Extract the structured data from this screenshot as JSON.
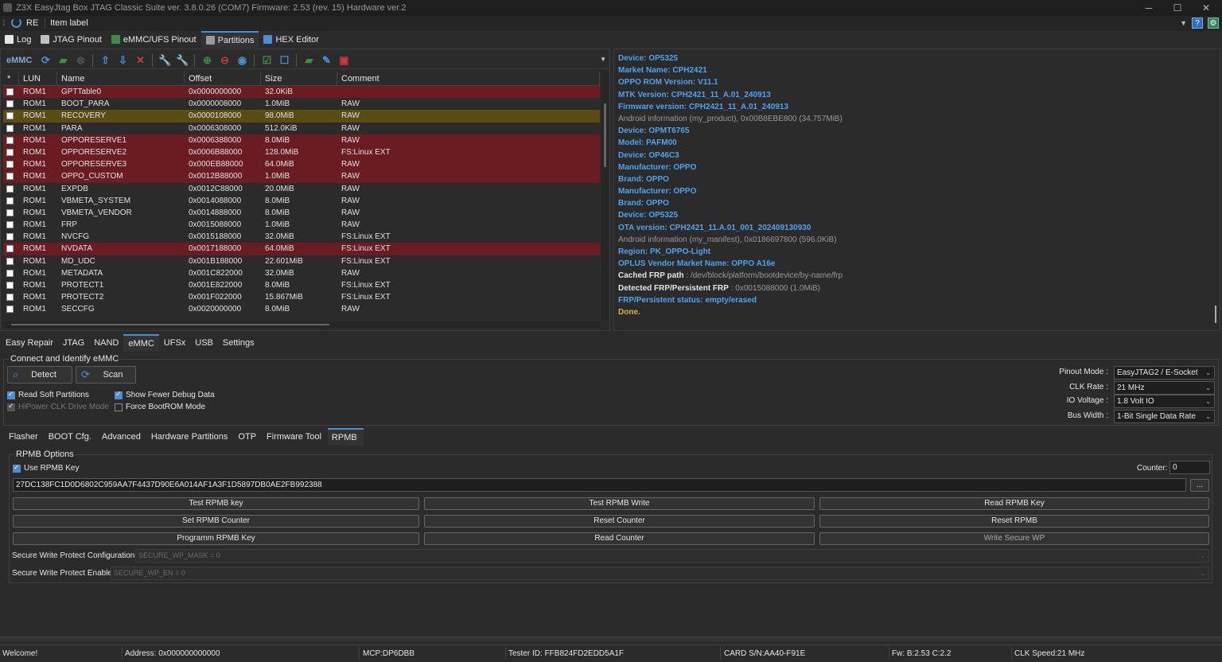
{
  "window": {
    "title": "Z3X EasyJtag Box JTAG Classic Suite ver. 3.8.0.26 (COM7) Firmware: 2.53 (rev. 15) Hardware ver.2",
    "minimize": "─",
    "maximize": "☐",
    "close": "✕"
  },
  "menubar": {
    "re_label": "RE",
    "item_label": "Item label",
    "dropdown": "▼",
    "help": "?",
    "settings": "⚙"
  },
  "top_tabs": [
    {
      "label": "Log",
      "icon": "log-icon",
      "color": "#e6e6e6"
    },
    {
      "label": "JTAG Pinout",
      "icon": "chip-icon",
      "color": "#c0c0c0"
    },
    {
      "label": "eMMC/UFS Pinout",
      "icon": "board-icon",
      "color": "#3e8e41"
    },
    {
      "label": "Partitions",
      "icon": "disk-icon",
      "color": "#9a9a9a",
      "active": true
    },
    {
      "label": "HEX Editor",
      "icon": "hex-icon",
      "color": "#4a8fd4"
    }
  ],
  "toolbar": {
    "emmc_label": "eMMC",
    "icons": [
      {
        "name": "refresh-icon",
        "glyph": "⟳",
        "color": "#4a8fd4"
      },
      {
        "name": "folder-open-icon",
        "glyph": "▰",
        "color": "#3e8e41"
      },
      {
        "name": "stop-icon",
        "glyph": "⊗",
        "color": "#555"
      },
      {
        "name": "upload-icon",
        "glyph": "⇧",
        "color": "#4a8fd4"
      },
      {
        "name": "download-icon",
        "glyph": "⇩",
        "color": "#4a8fd4"
      },
      {
        "name": "delete-icon",
        "glyph": "✕",
        "color": "#d23a3a"
      },
      {
        "name": "wrench-icon",
        "glyph": "🔧",
        "color": "#4a8fd4"
      },
      {
        "name": "tool-icon",
        "glyph": "🔧",
        "color": "#4a8fd4"
      },
      {
        "name": "add-icon",
        "glyph": "⊕",
        "color": "#3e8e41"
      },
      {
        "name": "remove-icon",
        "glyph": "⊖",
        "color": "#c23a3a"
      },
      {
        "name": "target-icon",
        "glyph": "◉",
        "color": "#4a8fd4"
      },
      {
        "name": "check-all-icon",
        "glyph": "☑",
        "color": "#3e8e41"
      },
      {
        "name": "uncheck-all-icon",
        "glyph": "☐",
        "color": "#4a8fd4"
      },
      {
        "name": "folder-icon",
        "glyph": "▰",
        "color": "#3e8e41"
      },
      {
        "name": "edit-icon",
        "glyph": "✎",
        "color": "#4a8fd4"
      },
      {
        "name": "erase-icon",
        "glyph": "▣",
        "color": "#d23a3a"
      }
    ],
    "menu_arrow": "▼"
  },
  "partitions": {
    "columns": [
      "*",
      "LUN",
      "Name",
      "Offset",
      "Size",
      "Comment"
    ],
    "rows": [
      {
        "lun": "ROM1",
        "name": "GPTTable0",
        "offset": "0x0000000000",
        "size": "32.0KiB",
        "comment": "",
        "hl": "red"
      },
      {
        "lun": "ROM1",
        "name": "BOOT_PARA",
        "offset": "0x0000008000",
        "size": "1.0MiB",
        "comment": "RAW",
        "hl": ""
      },
      {
        "lun": "ROM1",
        "name": "RECOVERY",
        "offset": "0x0000108000",
        "size": "98.0MiB",
        "comment": "RAW",
        "hl": "yellow"
      },
      {
        "lun": "ROM1",
        "name": "PARA",
        "offset": "0x0006308000",
        "size": "512.0KiB",
        "comment": "RAW",
        "hl": ""
      },
      {
        "lun": "ROM1",
        "name": "OPPORESERVE1",
        "offset": "0x0006388000",
        "size": "8.0MiB",
        "comment": "RAW",
        "hl": "red"
      },
      {
        "lun": "ROM1",
        "name": "OPPORESERVE2",
        "offset": "0x0006B88000",
        "size": "128.0MiB",
        "comment": "FS:Linux EXT",
        "hl": "red"
      },
      {
        "lun": "ROM1",
        "name": "OPPORESERVE3",
        "offset": "0x000EB88000",
        "size": "64.0MiB",
        "comment": "RAW",
        "hl": "red"
      },
      {
        "lun": "ROM1",
        "name": "OPPO_CUSTOM",
        "offset": "0x0012B88000",
        "size": "1.0MiB",
        "comment": "RAW",
        "hl": "red"
      },
      {
        "lun": "ROM1",
        "name": "EXPDB",
        "offset": "0x0012C88000",
        "size": "20.0MiB",
        "comment": "RAW",
        "hl": ""
      },
      {
        "lun": "ROM1",
        "name": "VBMETA_SYSTEM",
        "offset": "0x0014088000",
        "size": "8.0MiB",
        "comment": "RAW",
        "hl": ""
      },
      {
        "lun": "ROM1",
        "name": "VBMETA_VENDOR",
        "offset": "0x0014888000",
        "size": "8.0MiB",
        "comment": "RAW",
        "hl": ""
      },
      {
        "lun": "ROM1",
        "name": "FRP",
        "offset": "0x0015088000",
        "size": "1.0MiB",
        "comment": "RAW",
        "hl": ""
      },
      {
        "lun": "ROM1",
        "name": "NVCFG",
        "offset": "0x0015188000",
        "size": "32.0MiB",
        "comment": "FS:Linux EXT",
        "hl": ""
      },
      {
        "lun": "ROM1",
        "name": "NVDATA",
        "offset": "0x0017188000",
        "size": "64.0MiB",
        "comment": "FS:Linux EXT",
        "hl": "red"
      },
      {
        "lun": "ROM1",
        "name": "MD_UDC",
        "offset": "0x001B188000",
        "size": "22.601MiB",
        "comment": "FS:Linux EXT",
        "hl": ""
      },
      {
        "lun": "ROM1",
        "name": "METADATA",
        "offset": "0x001C822000",
        "size": "32.0MiB",
        "comment": "RAW",
        "hl": ""
      },
      {
        "lun": "ROM1",
        "name": "PROTECT1",
        "offset": "0x001E822000",
        "size": "8.0MiB",
        "comment": "FS:Linux EXT",
        "hl": ""
      },
      {
        "lun": "ROM1",
        "name": "PROTECT2",
        "offset": "0x001F022000",
        "size": "15.867MiB",
        "comment": "FS:Linux EXT",
        "hl": ""
      },
      {
        "lun": "ROM1",
        "name": "SECCFG",
        "offset": "0x0020000000",
        "size": "8.0MiB",
        "comment": "RAW",
        "hl": ""
      }
    ]
  },
  "log": [
    {
      "t": "b",
      "text": "Device: OP5325"
    },
    {
      "t": "b",
      "text": "Market Name: CPH2421"
    },
    {
      "t": "b",
      "text": "OPPO ROM Version: V11.1"
    },
    {
      "t": "b",
      "text": "MTK Version: CPH2421_11_A.01_240913"
    },
    {
      "t": "b",
      "text": "Firmware version: CPH2421_11_A.01_240913"
    },
    {
      "t": "g",
      "text": "Android information (my_product), 0x00B8EBE800 (34.757MiB)"
    },
    {
      "t": "b",
      "text": "Device: OPMT6765"
    },
    {
      "t": "b",
      "text": "Model: PAFM00"
    },
    {
      "t": "b",
      "text": "Device: OP46C3"
    },
    {
      "t": "b",
      "text": "Manufacturer: OPPO"
    },
    {
      "t": "b",
      "text": "Brand: OPPO"
    },
    {
      "t": "b",
      "text": "Manufacturer: OPPO"
    },
    {
      "t": "b",
      "text": "Brand: OPPO"
    },
    {
      "t": "b",
      "text": "Device: OP5325"
    },
    {
      "t": "b",
      "text": "OTA version: CPH2421_11.A.01_001_202409130930"
    },
    {
      "t": "g",
      "text": "Android information (my_manifest), 0x0186697800 (596.0KiB)"
    },
    {
      "t": "b",
      "text": "Region: PK_OPPO-Light"
    },
    {
      "t": "b",
      "text": "OPLUS Vendor Market Name: OPPO A16e"
    },
    {
      "t": "kv",
      "label": "Cached FRP path",
      "value": " : /dev/block/platform/bootdevice/by-name/frp"
    },
    {
      "t": "kv",
      "label": "Detected FRP/Persistent FRP",
      "value": " : 0x0015088000 (1.0MiB)"
    },
    {
      "t": "b",
      "text": "FRP/Persistent status: empty/erased"
    },
    {
      "t": "done",
      "text": "Done."
    }
  ],
  "mid_tabs": [
    {
      "label": "Easy Repair"
    },
    {
      "label": "JTAG"
    },
    {
      "label": "NAND"
    },
    {
      "label": "eMMC",
      "active": true
    },
    {
      "label": "UFSx"
    },
    {
      "label": "USB"
    },
    {
      "label": "Settings"
    }
  ],
  "connect": {
    "title": "Connect and Identify eMMC",
    "detect": "Detect",
    "scan": "Scan",
    "read_soft": "Read Soft Partitions",
    "hipower": "HiPower CLK Drive Mode",
    "show_fewer": "Show Fewer Debug Data",
    "force_bootrom": "Force BootROM Mode",
    "pinout_label": "Pinout Mode :",
    "pinout_value": "EasyJTAG2 / E-Socket",
    "clk_label": "CLK Rate :",
    "clk_value": "21 MHz",
    "io_label": "IO Voltage :",
    "io_value": "1.8 Volt IO",
    "bus_label": "Bus Width :",
    "bus_value": "1-Bit Single Data Rate"
  },
  "sub_tabs": [
    {
      "label": "Flasher"
    },
    {
      "label": "BOOT Cfg."
    },
    {
      "label": "Advanced"
    },
    {
      "label": "Hardware Partitions"
    },
    {
      "label": "OTP"
    },
    {
      "label": "Firmware Tool"
    },
    {
      "label": "RPMB",
      "active": true
    }
  ],
  "rpmb": {
    "title": "RPMB Options",
    "use_key": "Use RPMB Key",
    "counter_label": "Counter:",
    "counter_value": "0",
    "key_value": "27DC138FC1D0D6802C959AA7F4437D90E6A014AF1A3F1D5897DB0AE2FB992388",
    "browse": "...",
    "buttons": [
      [
        "Test RPMB key",
        "Test RPMB Write",
        "Read RPMB Key"
      ],
      [
        "Set RPMB Counter",
        "Reset Counter",
        "Reset RPMB"
      ],
      [
        "Programm RPMB Key",
        "Read Counter",
        "Write Secure WP"
      ]
    ],
    "swp_config_label": "Secure Write Protect Configuration:",
    "swp_config_value": "SECURE_WP_MASK = 0",
    "swp_enable_label": "Secure Write Protect Enable:",
    "swp_enable_value": "SECURE_WP_EN = 0"
  },
  "status": {
    "welcome": "Welcome!",
    "address": "Address: 0x000000000000",
    "mcp": "MCP:DP6DBB",
    "tester": "Tester ID: FFB824FD2EDD5A1F",
    "card": "CARD S/N:AA40-F91E",
    "fw": "Fw: B:2.53 C:2.2",
    "clk": "CLK Speed:21 MHz"
  },
  "colors": {
    "accent": "#4a8fd4",
    "row_red": "#6b1c22",
    "row_yellow": "#5a4c12",
    "log_blue": "#4fa3f0",
    "log_done": "#d6b43a"
  }
}
